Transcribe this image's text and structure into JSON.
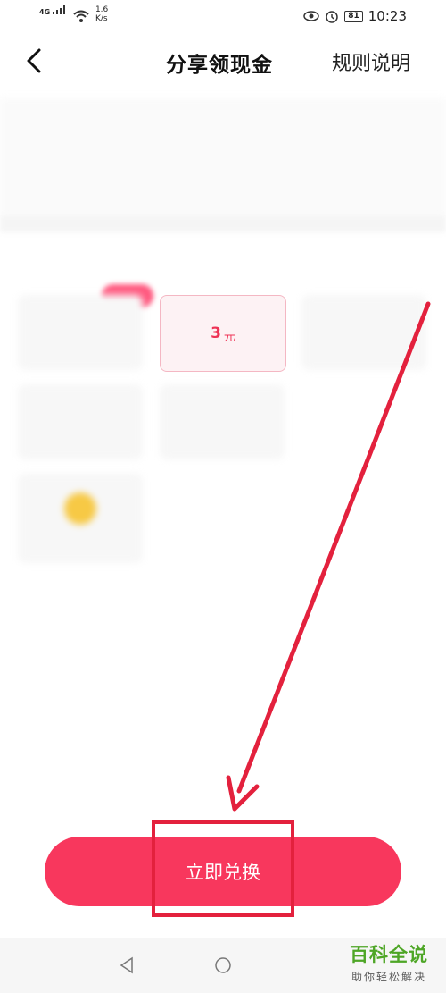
{
  "status_bar": {
    "network": "4G",
    "speed_value": "1.6",
    "speed_unit": "K/s",
    "battery": "81",
    "time": "10:23"
  },
  "header": {
    "title": "分享领现金",
    "rules_link": "规则说明"
  },
  "options": {
    "selected": {
      "value": "3",
      "unit": "元"
    }
  },
  "action": {
    "exchange_label": "立即兑换"
  },
  "watermark": {
    "title": "百科全说",
    "subtitle": "助你轻松解决"
  },
  "colors": {
    "accent": "#f8375d",
    "annotation": "#e3213d",
    "selected_border": "#f4b7c3",
    "watermark_green": "#4ea626"
  }
}
